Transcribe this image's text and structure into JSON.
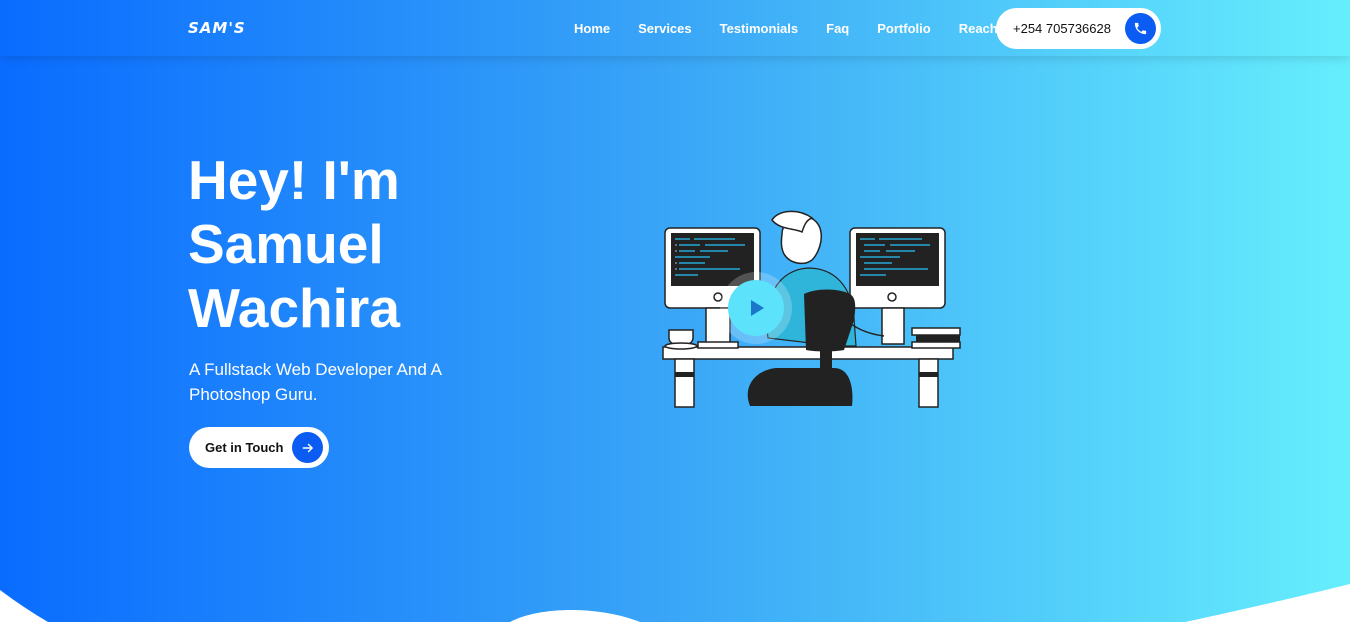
{
  "brand": {
    "logo_text": "SAM'S"
  },
  "nav": {
    "links": [
      {
        "label": "Home"
      },
      {
        "label": "Services"
      },
      {
        "label": "Testimonials"
      },
      {
        "label": "Faq"
      },
      {
        "label": "Portfolio"
      },
      {
        "label": "Reach Me"
      }
    ],
    "phone": {
      "number": "+254 705736628",
      "icon": "phone-icon"
    }
  },
  "hero": {
    "title": "Hey! I'm Samuel Wachira",
    "subtitle": "A Fullstack Web Developer And A Photoshop Guru.",
    "cta": {
      "label": "Get in Touch",
      "icon": "arrow-right-icon"
    },
    "illustration": "developer-at-desk-illustration",
    "play_icon": "play-icon"
  },
  "colors": {
    "gradient_start": "#0a6cff",
    "gradient_end": "#66eefd",
    "accent": "#0b5cf2",
    "play": "#5ce2fb",
    "white": "#ffffff"
  }
}
